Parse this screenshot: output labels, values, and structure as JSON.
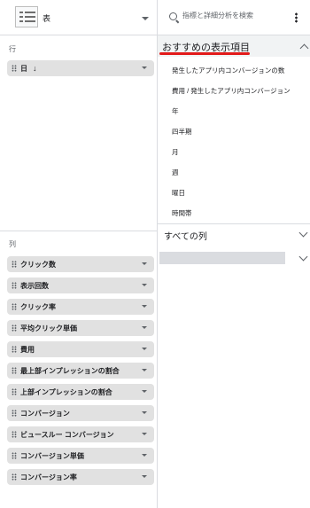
{
  "chart_picker": {
    "label": "表",
    "icon": "table-icon"
  },
  "rows_section": {
    "label": "行",
    "items": [
      {
        "label": "日",
        "sort": "↓"
      }
    ]
  },
  "columns_section": {
    "label": "列",
    "items": [
      "クリック数",
      "表示回数",
      "クリック率",
      "平均クリック単価",
      "費用",
      "最上部インプレッションの割合",
      "上部インプレッションの割合",
      "コンバージョン",
      "ビュースルー コンバージョン",
      "コンバージョン単価",
      "コンバージョン率"
    ]
  },
  "search": {
    "placeholder": "指標と詳細分析を検索"
  },
  "recommended": {
    "title": "おすすめの表示項目",
    "items": [
      "発生したアプリ内コンバージョンの数",
      "費用 / 発生したアプリ内コンバージョン",
      "年",
      "四半期",
      "月",
      "週",
      "曜日",
      "時間帯"
    ],
    "underline_color": "#e21a1a"
  },
  "all_columns": {
    "title": "すべての列"
  }
}
